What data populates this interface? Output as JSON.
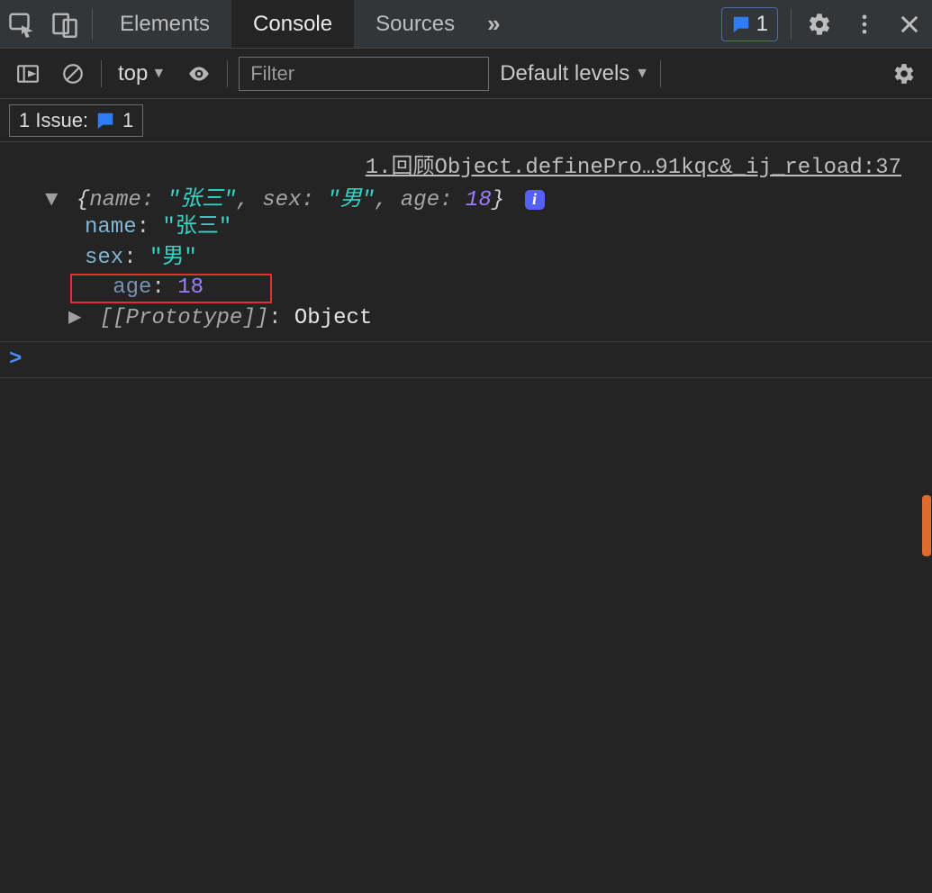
{
  "topbar": {
    "tabs": [
      "Elements",
      "Console",
      "Sources"
    ],
    "active_tab": "Console",
    "issue_count": "1"
  },
  "toolbar2": {
    "context": "top",
    "filter_placeholder": "Filter",
    "levels_label": "Default levels"
  },
  "issue_row": {
    "label": "1 Issue:",
    "count": "1"
  },
  "log": {
    "source_link": "1.回顾Object.definePro…91kqc&_ij_reload:37",
    "preview": {
      "open_brace": "{",
      "k1": "name: ",
      "v1": "\"张三\"",
      "sep1": ", ",
      "k2": "sex: ",
      "v2": "\"男\"",
      "sep2": ", ",
      "k3": "age: ",
      "v3": "18",
      "close_brace": "}"
    },
    "props": {
      "name_key": "name",
      "name_val": "\"张三\"",
      "sex_key": "sex",
      "sex_val": "\"男\"",
      "age_key": "age",
      "age_val": "18"
    },
    "proto": {
      "key": "[[Prototype]]",
      "val": "Object"
    }
  },
  "prompt": ">"
}
